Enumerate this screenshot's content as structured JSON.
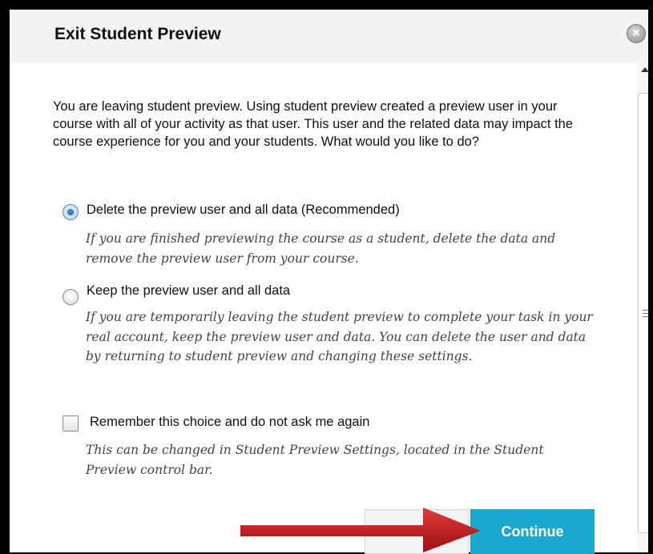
{
  "dialog": {
    "title": "Exit Student Preview",
    "intro": "You are leaving student preview. Using student preview created a preview user in your course with all of your activity as that user. This user and the related data may impact the course experience for you and your students. What would you like to do?",
    "options": [
      {
        "label": "Delete the preview user and all data (Recommended)",
        "description": "If you are finished previewing the course as a student, delete the data and remove the preview user from your course.",
        "selected": true
      },
      {
        "label": "Keep the preview user and all data",
        "description": "If you are temporarily leaving the student preview to complete your task in your real account, keep the preview user and data. You can delete the user and data by returning to student preview and changing these settings.",
        "selected": false
      }
    ],
    "remember": {
      "label": "Remember this choice and do not ask me again",
      "description": "This can be changed in Student Preview Settings, located in the Student Preview control bar.",
      "checked": false
    },
    "buttons": {
      "cancel": "C",
      "continue": "Continue"
    }
  },
  "colors": {
    "continue_button": "#1ba8cf",
    "arrow": "#c0161c"
  },
  "icons": {
    "close": "close-icon",
    "arrow": "red-arrow-annotation"
  }
}
